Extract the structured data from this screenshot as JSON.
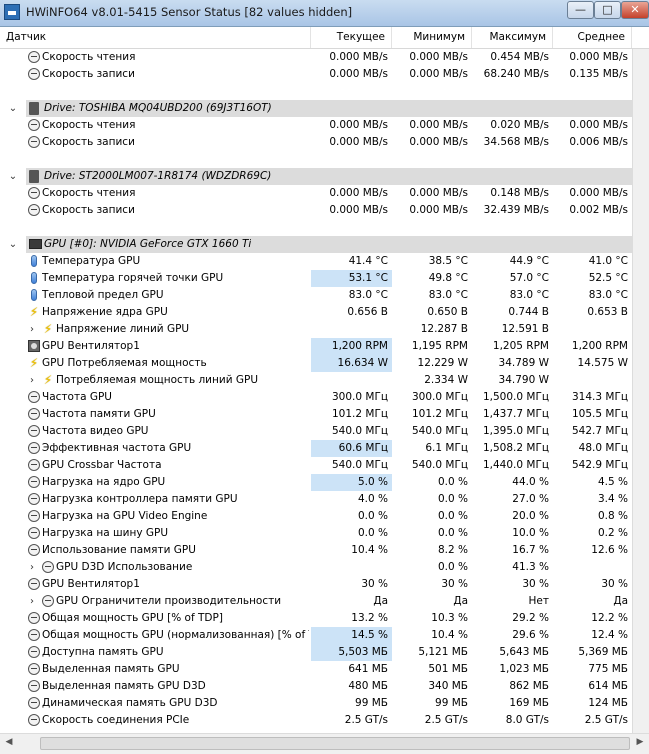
{
  "window": {
    "title": "HWiNFO64 v8.01-5415 Sensor Status [82 values hidden]",
    "min_glyph": "—",
    "max_glyph": "□",
    "close_glyph": "✕"
  },
  "columns": {
    "name": "Датчик",
    "current": "Текущее",
    "min": "Минимум",
    "max": "Максимум",
    "avg": "Среднее"
  },
  "colors": {
    "highlight": "#cce3f7",
    "group_bar": "#dcdcdc"
  },
  "rows": [
    {
      "type": "item",
      "icon": "clock",
      "label": "Скорость чтения",
      "cur": "0.000 MB/s",
      "min": "0.000 MB/s",
      "max": "0.454 MB/s",
      "avg": "0.000 MB/s"
    },
    {
      "type": "item",
      "icon": "clock",
      "label": "Скорость записи",
      "cur": "0.000 MB/s",
      "min": "0.000 MB/s",
      "max": "68.240 MB/s",
      "avg": "0.135 MB/s"
    },
    {
      "type": "spacer"
    },
    {
      "type": "group",
      "icon": "drive",
      "label": "Drive: TOSHIBA MQ04UBD200 (69J3T16OT)"
    },
    {
      "type": "item",
      "icon": "clock",
      "label": "Скорость чтения",
      "cur": "0.000 MB/s",
      "min": "0.000 MB/s",
      "max": "0.020 MB/s",
      "avg": "0.000 MB/s"
    },
    {
      "type": "item",
      "icon": "clock",
      "label": "Скорость записи",
      "cur": "0.000 MB/s",
      "min": "0.000 MB/s",
      "max": "34.568 MB/s",
      "avg": "0.006 MB/s"
    },
    {
      "type": "spacer"
    },
    {
      "type": "group",
      "icon": "drive",
      "label": "Drive: ST2000LM007-1R8174 (WDZDR69C)"
    },
    {
      "type": "item",
      "icon": "clock",
      "label": "Скорость чтения",
      "cur": "0.000 MB/s",
      "min": "0.000 MB/s",
      "max": "0.148 MB/s",
      "avg": "0.000 MB/s"
    },
    {
      "type": "item",
      "icon": "clock",
      "label": "Скорость записи",
      "cur": "0.000 MB/s",
      "min": "0.000 MB/s",
      "max": "32.439 MB/s",
      "avg": "0.002 MB/s"
    },
    {
      "type": "spacer"
    },
    {
      "type": "group",
      "icon": "gpu",
      "label": "GPU [#0]: NVIDIA GeForce GTX 1660 Ti"
    },
    {
      "type": "item",
      "icon": "therm",
      "label": "Температура GPU",
      "cur": "41.4 °C",
      "min": "38.5 °C",
      "max": "44.9 °C",
      "avg": "41.0 °C"
    },
    {
      "type": "item",
      "icon": "therm",
      "label": "Температура горячей точки GPU",
      "cur": "53.1 °C",
      "min": "49.8 °C",
      "max": "57.0 °C",
      "avg": "52.5 °C",
      "hl": true
    },
    {
      "type": "item",
      "icon": "therm",
      "label": "Тепловой предел GPU",
      "cur": "83.0 °C",
      "min": "83.0 °C",
      "max": "83.0 °C",
      "avg": "83.0 °C"
    },
    {
      "type": "item",
      "icon": "bolt",
      "label": "Напряжение ядра GPU",
      "cur": "0.656 В",
      "min": "0.650 В",
      "max": "0.744 В",
      "avg": "0.653 В"
    },
    {
      "type": "sub",
      "icon": "bolt",
      "label": "Напряжение линий GPU",
      "cur": "",
      "min": "12.287 В",
      "max": "12.591 В",
      "avg": ""
    },
    {
      "type": "item",
      "icon": "fan",
      "label": "GPU Вентилятор1",
      "cur": "1,200 RPM",
      "min": "1,195 RPM",
      "max": "1,205 RPM",
      "avg": "1,200 RPM",
      "hl": true
    },
    {
      "type": "item",
      "icon": "bolt",
      "label": "GPU Потребляемая мощность",
      "cur": "16.634 W",
      "min": "12.229 W",
      "max": "34.789 W",
      "avg": "14.575 W",
      "hl": true
    },
    {
      "type": "sub",
      "icon": "bolt",
      "label": "Потребляемая мощность линий GPU",
      "cur": "",
      "min": "2.334 W",
      "max": "34.790 W",
      "avg": ""
    },
    {
      "type": "item",
      "icon": "clock",
      "label": "Частота GPU",
      "cur": "300.0 МГц",
      "min": "300.0 МГц",
      "max": "1,500.0 МГц",
      "avg": "314.3 МГц"
    },
    {
      "type": "item",
      "icon": "clock",
      "label": "Частота памяти GPU",
      "cur": "101.2 МГц",
      "min": "101.2 МГц",
      "max": "1,437.7 МГц",
      "avg": "105.5 МГц"
    },
    {
      "type": "item",
      "icon": "clock",
      "label": "Частота видео GPU",
      "cur": "540.0 МГц",
      "min": "540.0 МГц",
      "max": "1,395.0 МГц",
      "avg": "542.7 МГц"
    },
    {
      "type": "item",
      "icon": "clock",
      "label": "Эффективная частота GPU",
      "cur": "60.6 МГц",
      "min": "6.1 МГц",
      "max": "1,508.2 МГц",
      "avg": "48.0 МГц",
      "hl": true
    },
    {
      "type": "item",
      "icon": "clock",
      "label": "GPU Crossbar Частота",
      "cur": "540.0 МГц",
      "min": "540.0 МГц",
      "max": "1,440.0 МГц",
      "avg": "542.9 МГц"
    },
    {
      "type": "item",
      "icon": "clock",
      "label": "Нагрузка на ядро GPU",
      "cur": "5.0 %",
      "min": "0.0 %",
      "max": "44.0 %",
      "avg": "4.5 %",
      "hl": true
    },
    {
      "type": "item",
      "icon": "clock",
      "label": "Нагрузка контроллера памяти GPU",
      "cur": "4.0 %",
      "min": "0.0 %",
      "max": "27.0 %",
      "avg": "3.4 %"
    },
    {
      "type": "item",
      "icon": "clock",
      "label": "Нагрузка на GPU Video Engine",
      "cur": "0.0 %",
      "min": "0.0 %",
      "max": "20.0 %",
      "avg": "0.8 %"
    },
    {
      "type": "item",
      "icon": "clock",
      "label": "Нагрузка на шину GPU",
      "cur": "0.0 %",
      "min": "0.0 %",
      "max": "10.0 %",
      "avg": "0.2 %"
    },
    {
      "type": "item",
      "icon": "clock",
      "label": "Использование памяти GPU",
      "cur": "10.4 %",
      "min": "8.2 %",
      "max": "16.7 %",
      "avg": "12.6 %"
    },
    {
      "type": "sub",
      "icon": "clock",
      "label": "GPU D3D Использование",
      "cur": "",
      "min": "0.0 %",
      "max": "41.3 %",
      "avg": ""
    },
    {
      "type": "item",
      "icon": "clock",
      "label": "GPU Вентилятор1",
      "cur": "30 %",
      "min": "30 %",
      "max": "30 %",
      "avg": "30 %"
    },
    {
      "type": "sub",
      "icon": "clock",
      "label": "GPU Ограничители производительности",
      "cur": "",
      "min": "Да",
      "max": "Нет",
      "avg": "Да",
      "extra": "Да"
    },
    {
      "type": "item",
      "icon": "clock",
      "label": "Общая мощность GPU [% of TDP]",
      "cur": "13.2 %",
      "min": "10.3 %",
      "max": "29.2 %",
      "avg": "12.2 %"
    },
    {
      "type": "item",
      "icon": "clock",
      "label": "Общая мощность GPU (нормализованная) [% of T...",
      "cur": "14.5 %",
      "min": "10.4 %",
      "max": "29.6 %",
      "avg": "12.4 %",
      "hl": true
    },
    {
      "type": "item",
      "icon": "clock",
      "label": "Доступна память GPU",
      "cur": "5,503 МБ",
      "min": "5,121 МБ",
      "max": "5,643 МБ",
      "avg": "5,369 МБ",
      "hl": true
    },
    {
      "type": "item",
      "icon": "clock",
      "label": "Выделенная память GPU",
      "cur": "641 МБ",
      "min": "501 МБ",
      "max": "1,023 МБ",
      "avg": "775 МБ"
    },
    {
      "type": "item",
      "icon": "clock",
      "label": "Выделенная память GPU D3D",
      "cur": "480 МБ",
      "min": "340 МБ",
      "max": "862 МБ",
      "avg": "614 МБ"
    },
    {
      "type": "item",
      "icon": "clock",
      "label": "Динамическая память GPU D3D",
      "cur": "99 МБ",
      "min": "99 МБ",
      "max": "169 МБ",
      "avg": "124 МБ"
    },
    {
      "type": "item",
      "icon": "clock",
      "label": "Скорость соединения PCIe",
      "cur": "2.5 GT/s",
      "min": "2.5 GT/s",
      "max": "8.0 GT/s",
      "avg": "2.5 GT/s"
    }
  ]
}
